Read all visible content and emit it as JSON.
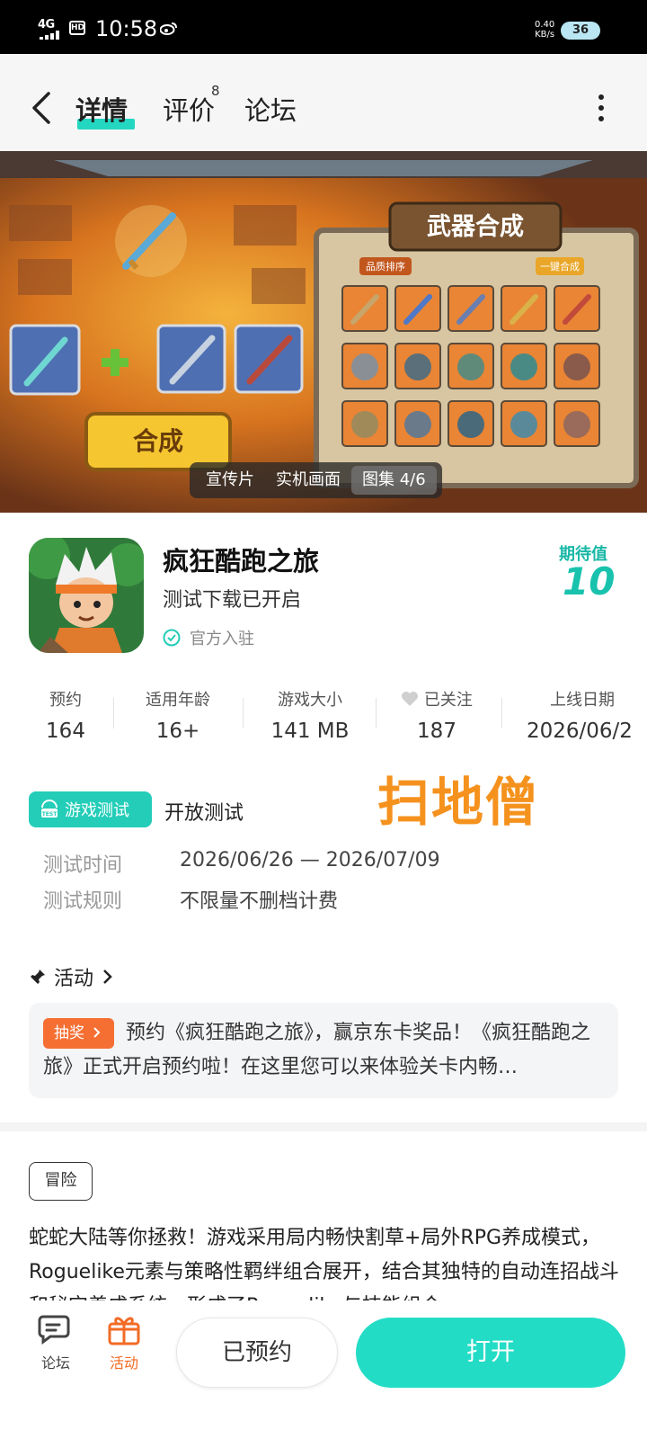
{
  "status_bar": {
    "network": "4G",
    "hd": "HD",
    "time": "10:58",
    "speed_value": "0.40",
    "speed_unit": "KB/s",
    "battery": "36"
  },
  "nav": {
    "tabs": [
      {
        "label": "详情",
        "active": true
      },
      {
        "label": "评价",
        "badge": "8"
      },
      {
        "label": "论坛"
      }
    ]
  },
  "banner": {
    "title_badge": "武器合成",
    "sort_label": "品质排序",
    "merge_all_label": "一键合成",
    "merge_button": "合成",
    "media_tabs": [
      {
        "label": "宣传片"
      },
      {
        "label": "实机画面"
      },
      {
        "label": "图集 4/6",
        "active": true
      }
    ]
  },
  "app": {
    "name": "疯狂酷跑之旅",
    "subtitle": "测试下载已开启",
    "verified": "官方入驻",
    "expect_label": "期待值",
    "expect_value": "10"
  },
  "stats": [
    {
      "label": "预约",
      "value": "164"
    },
    {
      "label": "适用年龄",
      "value": "16+"
    },
    {
      "label": "游戏大小",
      "value": "141 MB"
    },
    {
      "label": "已关注",
      "value": "187",
      "icon": "heart-icon"
    },
    {
      "label": "上线日期",
      "value": "2026/06/2"
    }
  ],
  "test": {
    "badge": "游戏测试",
    "type": "开放测试",
    "rows": [
      {
        "key": "测试时间",
        "value": "2026/06/26 — 2026/07/09"
      },
      {
        "key": "测试规则",
        "value": "不限量不删档计费"
      }
    ]
  },
  "watermark": "扫地僧",
  "activity": {
    "title": "活动",
    "badge": "抽奖",
    "text": "预约《疯狂酷跑之旅》，赢京东卡奖品！《疯狂酷跑之旅》正式开启预约啦！在这里您可以来体验关卡内畅…"
  },
  "tag": "冒险",
  "description": "蛇蛇大陆等你拯救！游戏采用局内畅快割草+局外RPG养成模式，Roguelike元素与策略性羁绊组合展开，结合其独特的自动连招战斗和秘宝养成系统，形成了Roguelike与技能组合",
  "bottom_bar": {
    "forum": "论坛",
    "activity": "活动",
    "reserved": "已预约",
    "open": "打开"
  },
  "colors": {
    "accent": "#23d7c1",
    "orange": "#f56f33",
    "watermark": "#f5921e"
  }
}
